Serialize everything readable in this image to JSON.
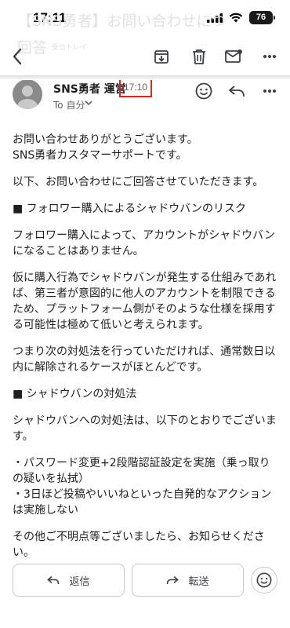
{
  "status_bar": {
    "time": "17:11",
    "battery": "76"
  },
  "background_subject": {
    "line1": "【SNS勇者】お問い合わせにつ",
    "line2": "回答",
    "inbox_label": "受信トレイ"
  },
  "toolbar": {
    "back": "back-icon",
    "archive": "archive-icon",
    "delete": "trash-icon",
    "mark_unread": "mail-icon",
    "more": "more-icon"
  },
  "message": {
    "sender": "SNS勇者 運営",
    "time": "17:10",
    "to": "To 自分",
    "paragraphs": [
      "お問い合わせありがとうございます。\nSNS勇者カスタマーサポートです。",
      "以下、お問い合わせにご回答させていただきます。",
      "■ フォロワー購入によるシャドウバンのリスク",
      "フォロワー購入によって、アカウントがシャドウバンになることはありません。",
      "仮に購入行為でシャドウバンが発生する仕組みであれば、第三者が意図的に他人のアカウントを制限できるため、プラットフォーム側がそのような仕様を採用する可能性は極めて低いと考えられます。",
      "つまり次の対処法を行っていただければ、通常数日以内に解除されるケースがほとんどです。",
      "■ シャドウバンの対処法",
      "シャドウバンへの対処法は、以下のとおりでございます。",
      "・パスワード変更+2段階認証設定を実施（乗っ取りの疑いを払拭）\n・3日ほど投稿やいいねといった自発的なアクションは実施しない",
      "その他ご不明点等ございましたら、お知らせください。"
    ]
  },
  "actions": {
    "reply": "返信",
    "forward": "転送"
  }
}
